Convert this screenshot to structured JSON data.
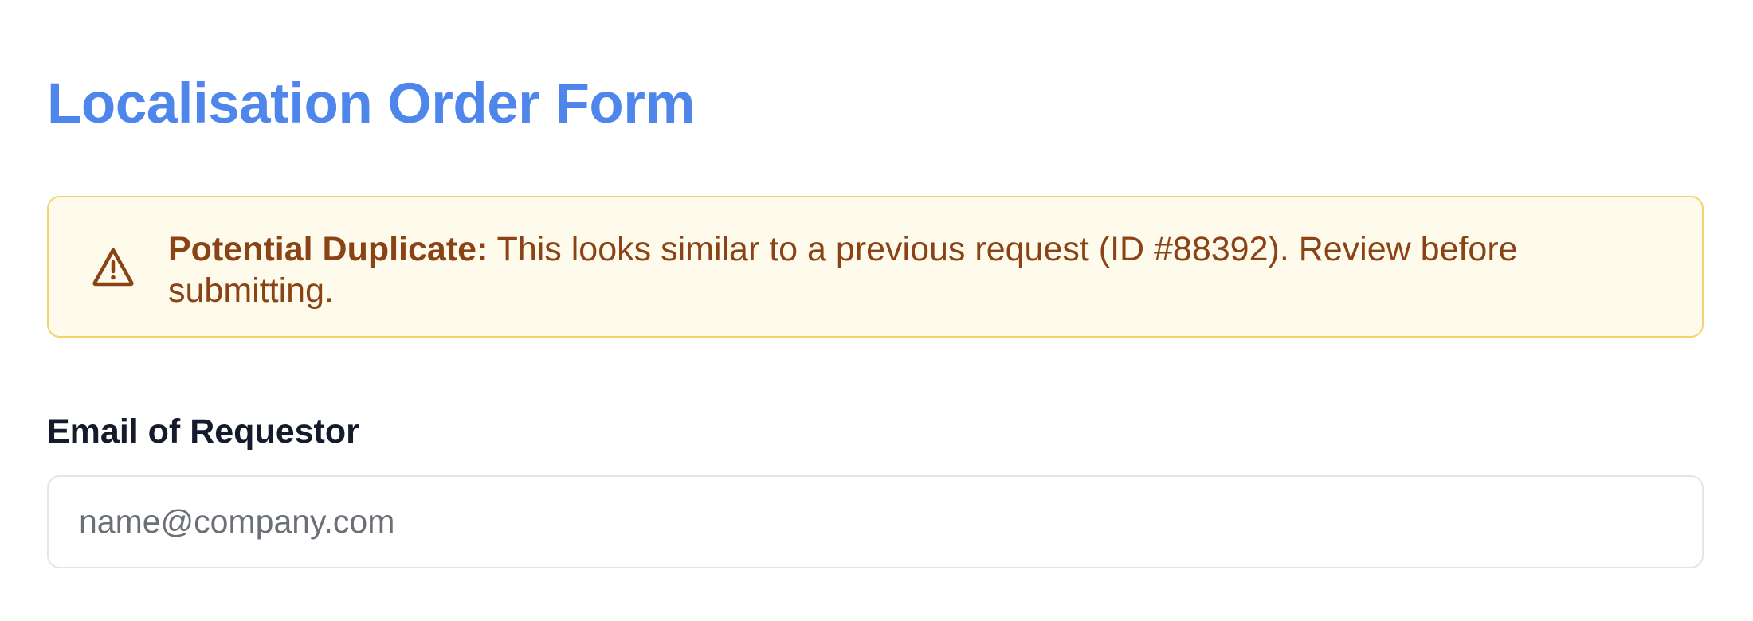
{
  "page": {
    "title": "Localisation Order Form"
  },
  "alert": {
    "icon": "warning-triangle-icon",
    "title": "Potential Duplicate:",
    "message": " This looks similar to a previous request (ID #88392). Review before submitting.",
    "colors": {
      "border": "#f4d36b",
      "background": "#fffbec",
      "text": "#8a4315"
    }
  },
  "form": {
    "email": {
      "label": "Email of Requestor",
      "placeholder": "name@company.com",
      "value": ""
    }
  },
  "colors": {
    "accent": "#4e86ec",
    "label": "#151a2c",
    "input_border": "#e3e5e8"
  }
}
